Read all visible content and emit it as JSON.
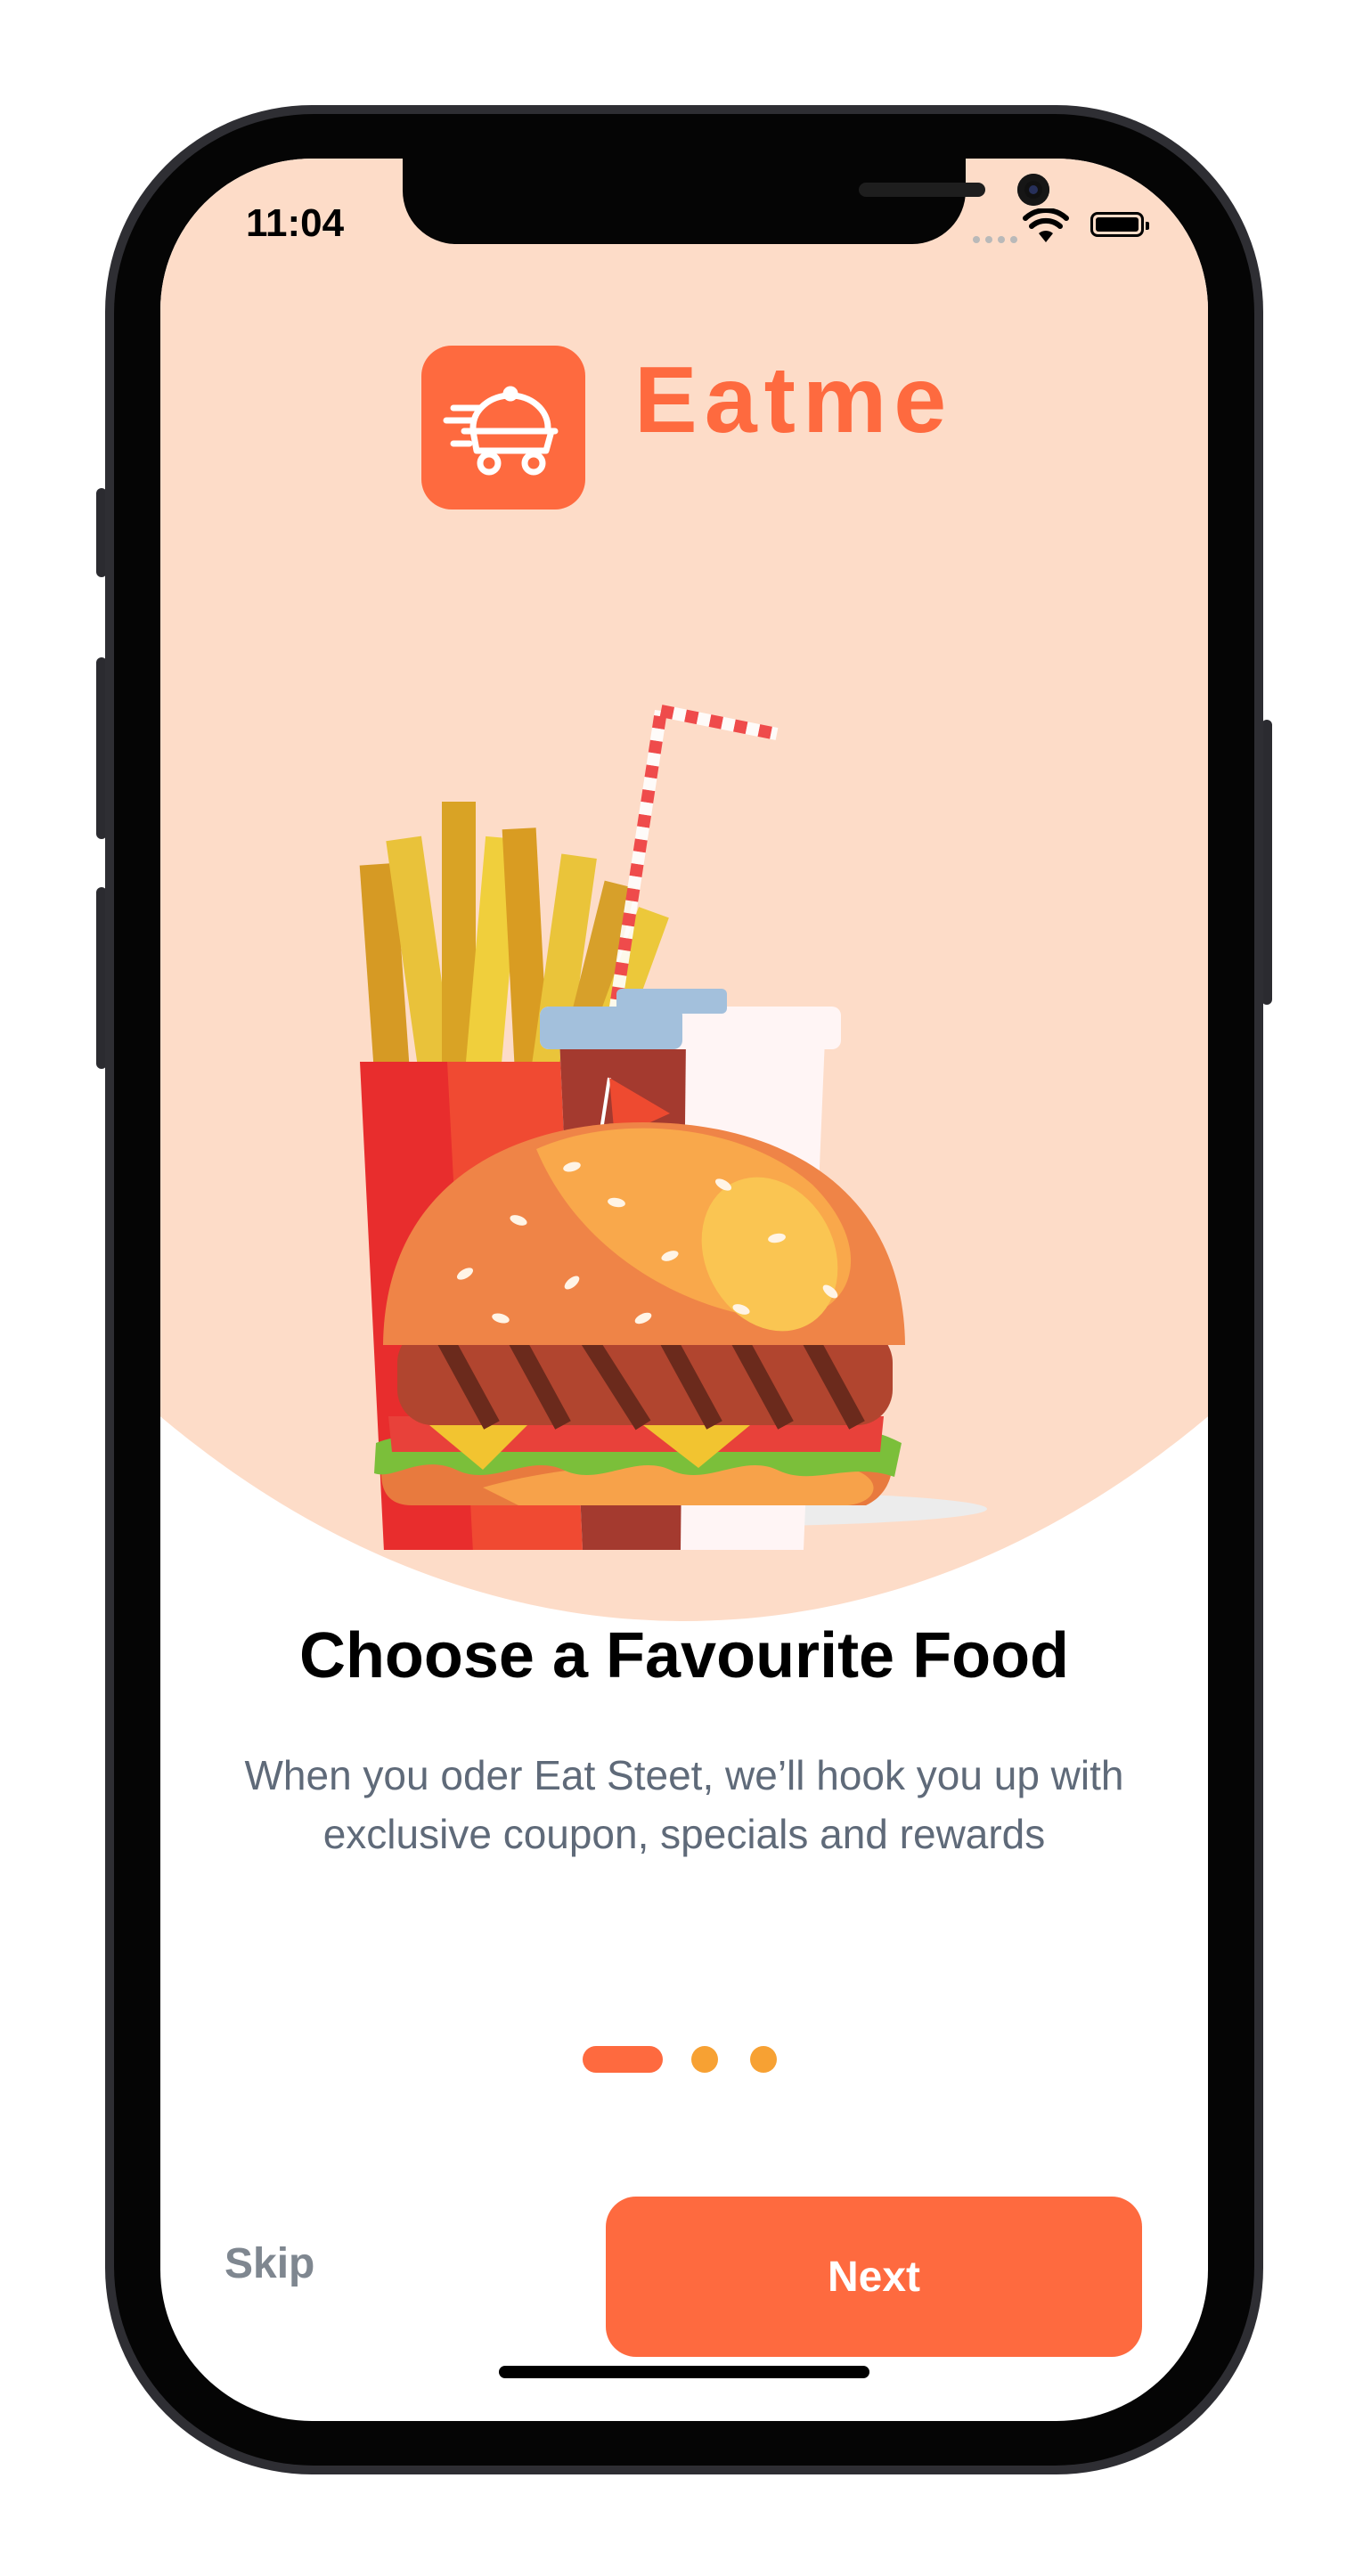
{
  "status_bar": {
    "time": "11:04",
    "icons": [
      "cellular-signal-icon",
      "wifi-icon",
      "battery-icon"
    ]
  },
  "brand": {
    "logo_icon": "delivery-cloche-icon",
    "name": "Eatme"
  },
  "illustration": {
    "items": [
      "french-fries",
      "soft-drink-cup",
      "burger"
    ]
  },
  "onboarding": {
    "title": "Choose a Favourite Food",
    "description": "When you oder Eat Steet, we’ll hook you up with exclusive coupon, specials and rewards",
    "page_indicator": {
      "current": 1,
      "total": 3
    }
  },
  "actions": {
    "skip_label": "Skip",
    "next_label": "Next"
  },
  "colors": {
    "accent": "#fe6a3f",
    "peach_background": "#fddcc8",
    "dot_inactive": "#f7a133",
    "text_secondary": "#5f6a79",
    "skip_text": "#7f8790"
  }
}
